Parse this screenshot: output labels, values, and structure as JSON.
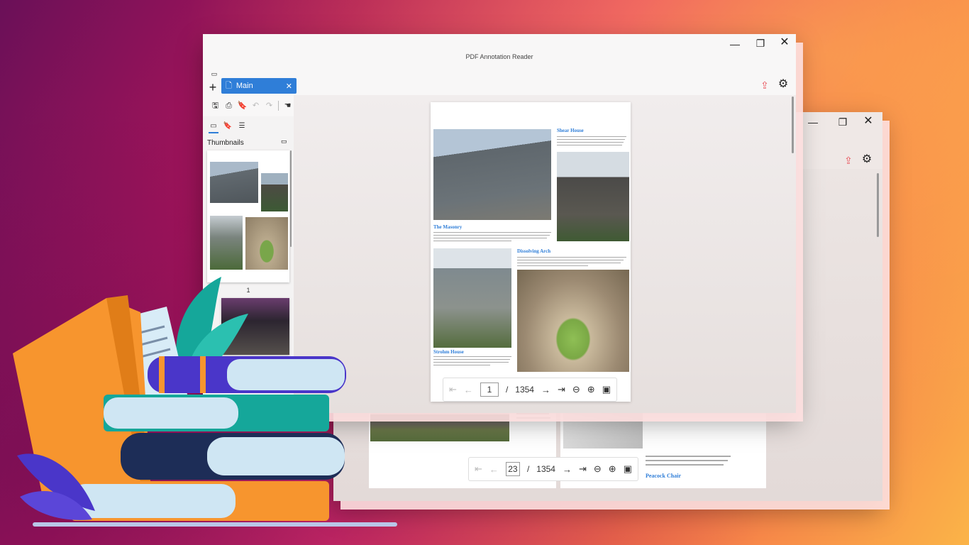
{
  "app": {
    "title": "PDF Annotation Reader"
  },
  "tabs": [
    {
      "label": "Main",
      "active": true
    }
  ],
  "sidebar": {
    "panel_title": "Thumbnails",
    "first_page_number": "1"
  },
  "document": {
    "current_page": "1",
    "total_pages": "1354",
    "page_separator": "/",
    "sections": [
      {
        "title": "Shear House"
      },
      {
        "title": "The Masonry"
      },
      {
        "title": "Dissolving Arch"
      },
      {
        "title": "Strohm House"
      }
    ]
  },
  "back_window": {
    "current_page": "23",
    "total_pages": "1354",
    "page_separator": "/",
    "section_title": "Peacock Chair"
  },
  "icons": {
    "new_tab": "plus-icon",
    "share": "share-icon",
    "settings": "gear-icon",
    "minimize": "minimize-icon",
    "restore": "restore-icon",
    "close": "close-icon"
  },
  "colors": {
    "accent": "#2f7ed8",
    "book_orange": "#f7952e",
    "book_teal": "#15a79a",
    "book_navy": "#1d2d57",
    "book_purple": "#4a36c9",
    "book_light": "#cfe6f3"
  }
}
